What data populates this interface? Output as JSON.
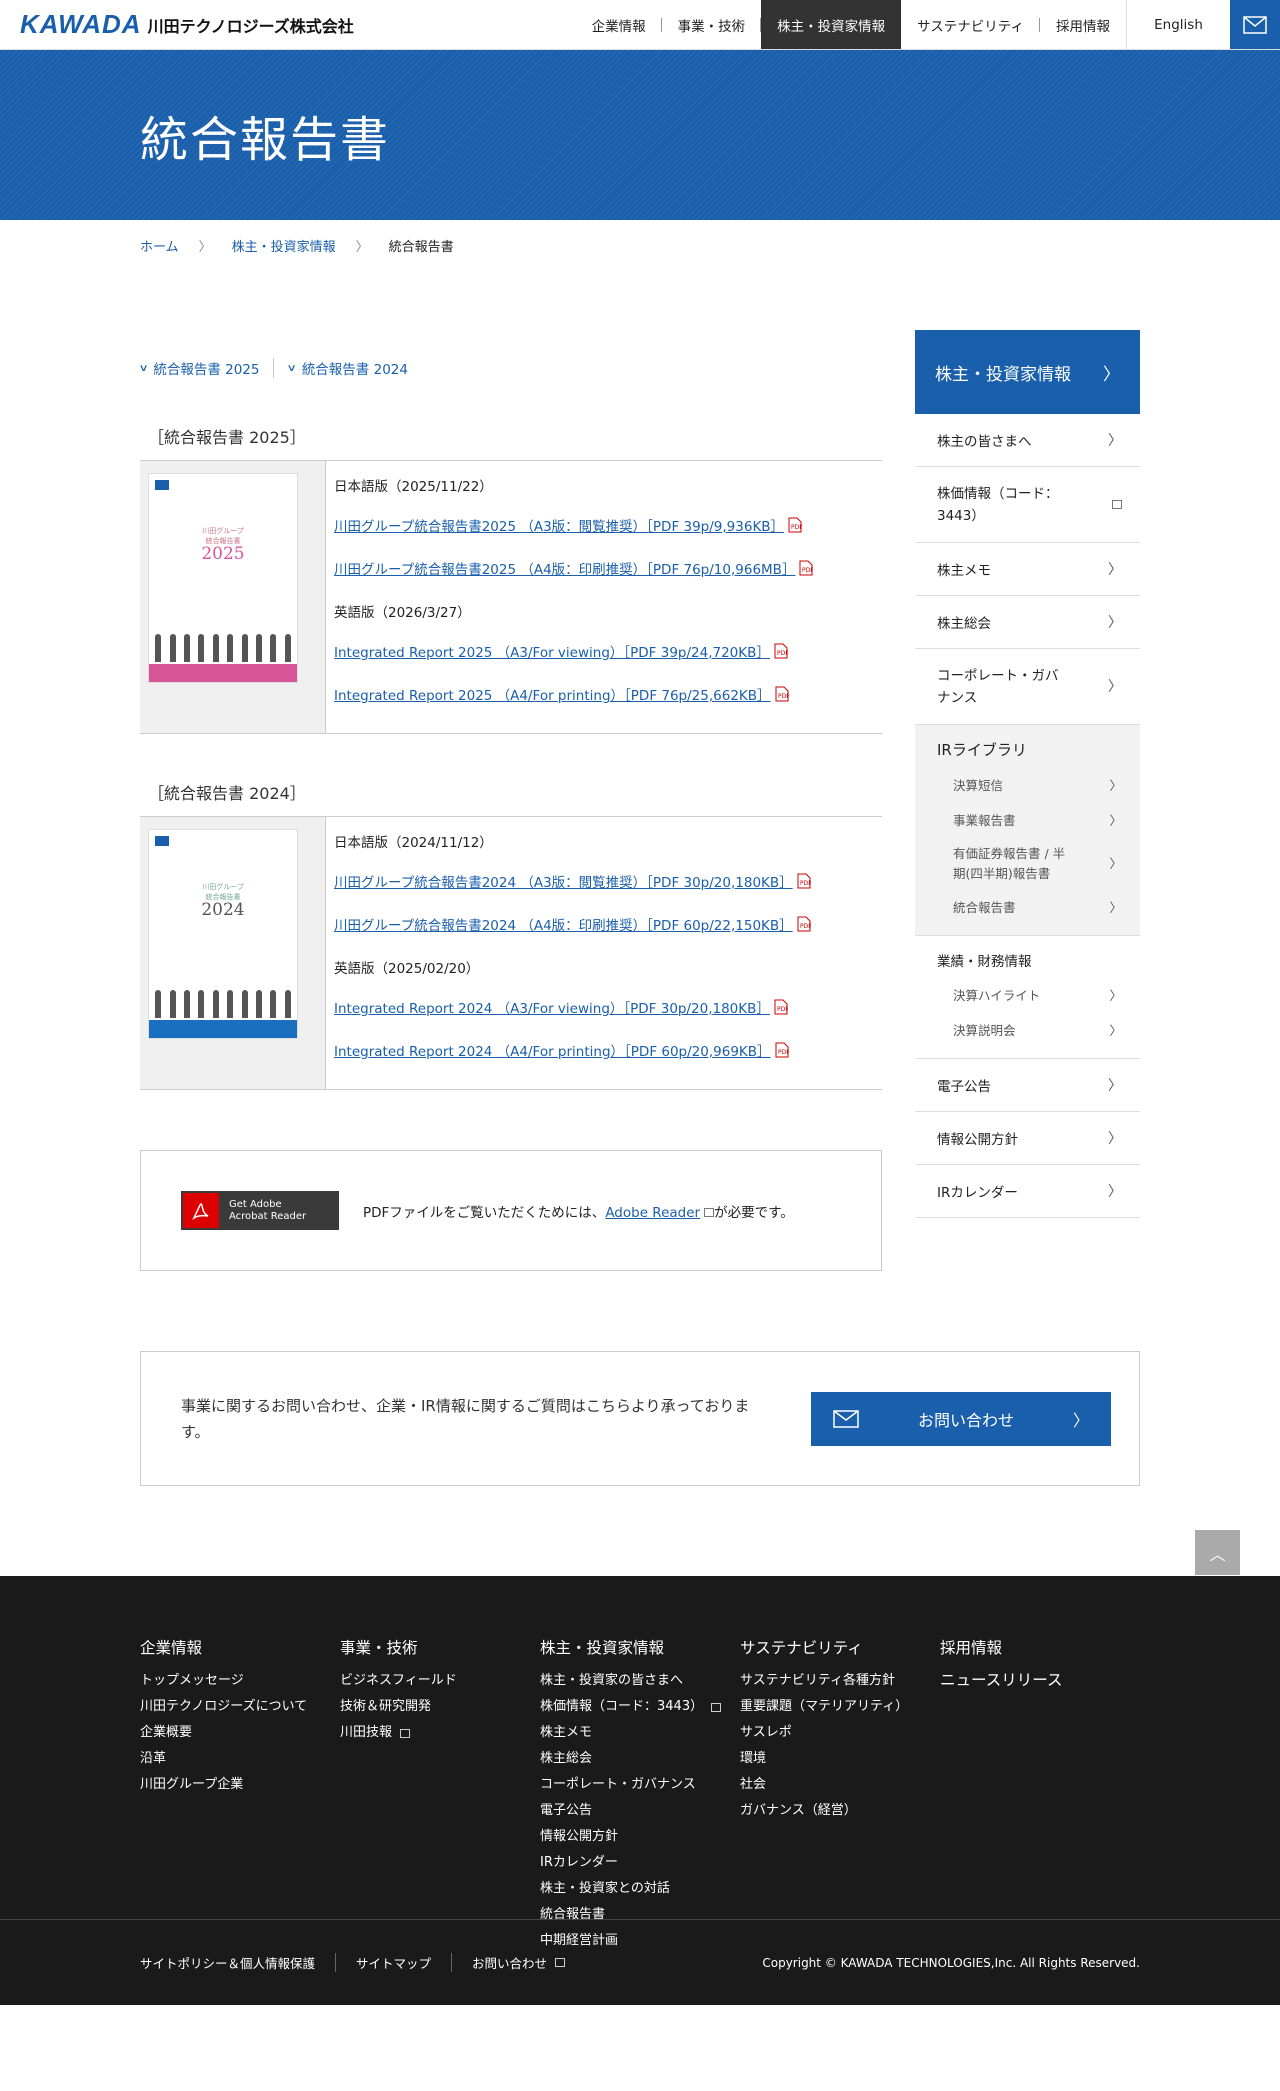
{
  "header": {
    "logo_mark": "KAWADA",
    "logo_name": "川田テクノロジーズ株式会社",
    "nav": [
      "企業情報",
      "事業・技術",
      "株主・投資家情報",
      "サステナビリティ",
      "採用情報"
    ],
    "english": "English"
  },
  "hero": {
    "title": "統合報告書"
  },
  "breadcrumb": {
    "home": "ホーム",
    "parent": "株主・投資家情報",
    "current": "統合報告書"
  },
  "anchors": [
    "統合報告書 2025",
    "統合報告書 2024"
  ],
  "reports": [
    {
      "title": "［統合報告書 2025］",
      "cover_title": "川田グループ\n統合報告書",
      "cover_year": "2025",
      "cover_color": "#d9559a",
      "jp_label": "日本語版（2025/11/22）",
      "jp_links": [
        "川田グループ統合報告書2025 （A3版：閲覧推奨）［PDF 39p/9,936KB］",
        "川田グループ統合報告書2025 （A4版：印刷推奨）［PDF 76p/10,966MB］"
      ],
      "en_label": "英語版（2026/3/27）",
      "en_links": [
        "Integrated Report 2025 （A3/For viewing）［PDF 39p/24,720KB］",
        "Integrated Report 2025 （A4/For printing）［PDF 76p/25,662KB］"
      ]
    },
    {
      "title": "［統合報告書 2024］",
      "cover_title": "川田グループ\n統合報告書",
      "cover_year": "2024",
      "cover_color": "#1a6fc0",
      "jp_label": "日本語版（2024/11/12）",
      "jp_links": [
        "川田グループ統合報告書2024 （A3版：閲覧推奨）［PDF 30p/20,180KB］",
        "川田グループ統合報告書2024 （A4版：印刷推奨）［PDF 60p/22,150KB］"
      ],
      "en_label": "英語版（2025/02/20）",
      "en_links": [
        "Integrated Report 2024 （A3/For viewing）［PDF 30p/20,180KB］",
        "Integrated Report 2024 （A4/For printing）［PDF 60p/20,969KB］"
      ]
    }
  ],
  "adobe": {
    "badge_line1": "Get Adobe",
    "badge_line2": "Acrobat Reader",
    "text_before": "PDFファイルをご覧いただくためには、",
    "link": "Adobe Reader",
    "text_after": "が必要です。"
  },
  "side": {
    "head": "株主・投資家情報",
    "items": [
      "株主の皆さまへ",
      "株価情報（コード：3443）",
      "株主メモ",
      "株主総会",
      "コーポレート・ガバナンス"
    ],
    "ir_library": {
      "title": "IRライブラリ",
      "items": [
        "決算短信",
        "事業報告書",
        "有価証券報告書 / 半期(四半期)報告書",
        "統合報告書"
      ]
    },
    "finance": {
      "title": "業績・財務情報",
      "items": [
        "決算ハイライト",
        "決算説明会"
      ]
    },
    "bottom_items": [
      "電子公告",
      "情報公開方針",
      "IRカレンダー"
    ]
  },
  "contact": {
    "message": "事業に関するお問い合わせ、企業・IR情報に関するご質問はこちらより承っております。",
    "button": "お問い合わせ"
  },
  "footer": {
    "cols": [
      {
        "title": "企業情報",
        "links": [
          "トップメッセージ",
          "川田テクノロジーズについて",
          "企業概要",
          "沿革",
          "川田グループ企業"
        ]
      },
      {
        "title": "事業・技術",
        "links": [
          "ビジネスフィールド",
          "技術＆研究開発",
          "川田技報"
        ]
      },
      {
        "title": "株主・投資家情報",
        "links": [
          "株主・投資家の皆さまへ",
          "株価情報（コード：3443）",
          "株主メモ",
          "株主総会",
          "コーポレート・ガバナンス",
          "電子公告",
          "情報公開方針",
          "IRカレンダー",
          "株主・投資家との対話",
          "統合報告書",
          "中期経営計画"
        ]
      },
      {
        "title": "サステナビリティ",
        "links": [
          "サステナビリティ各種方針",
          "重要課題（マテリアリティ）",
          "サスレポ",
          "環境",
          "社会",
          "ガバナンス（経営）"
        ]
      },
      {
        "title": "採用情報",
        "links": [
          "ニュースリリース"
        ]
      }
    ],
    "bottom": [
      "サイトポリシー＆個人情報保護",
      "サイトマップ",
      "お問い合わせ"
    ],
    "copyright": "Copyright © KAWADA TECHNOLOGIES,Inc. All Rights Reserved."
  }
}
